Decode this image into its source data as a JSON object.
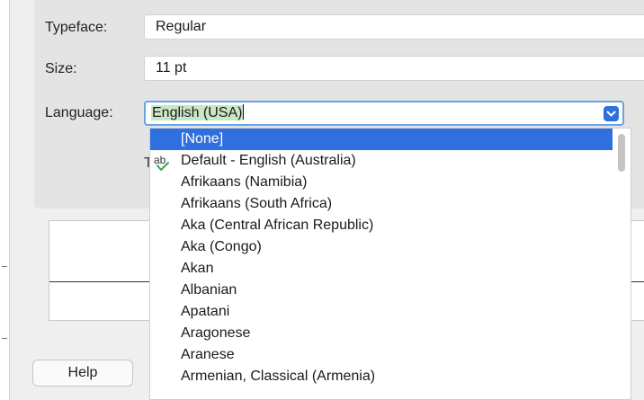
{
  "form": {
    "typeface_label": "Typeface:",
    "typeface_value": "Regular",
    "size_label": "Size:",
    "size_value": "11 pt",
    "language_label": "Language:",
    "language_value": "English (USA)",
    "partially_hidden_char": "T"
  },
  "dropdown": {
    "items": [
      "[None]",
      "Default - English (Australia)",
      "Afrikaans (Namibia)",
      "Afrikaans (South Africa)",
      "Aka (Central African Republic)",
      "Aka (Congo)",
      "Akan",
      "Albanian",
      "Apatani",
      "Aragonese",
      "Aranese",
      "Armenian, Classical (Armenia)"
    ],
    "selected_index": 0,
    "spell_icon_text": "ab"
  },
  "buttons": {
    "help_label": "Help"
  },
  "colors": {
    "accent": "#2f6fe0",
    "selection_green": "#c9e6c6",
    "spell_check": "#3aa55a"
  },
  "icons": {
    "dropdown": "chevron-down-icon",
    "spell": "spellcheck-icon"
  }
}
